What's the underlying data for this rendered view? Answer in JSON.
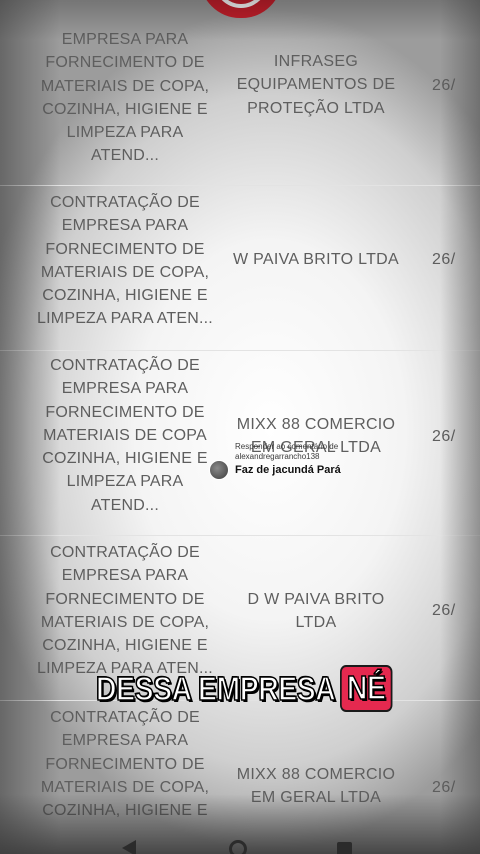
{
  "table": {
    "rows": [
      {
        "description": "EMPRESA PARA\nFORNECIMENTO DE\nMATERIAIS DE COPA,\nCOZINHA, HIGIENE E\nLIMPEZA PARA\nATEND...",
        "company": "INFRASEG\nEQUIPAMENTOS DE\nPROTEÇÃO LTDA",
        "date": "26/"
      },
      {
        "description": "CONTRATAÇÃO DE\nEMPRESA PARA\nFORNECIMENTO  DE\nMATERIAIS DE COPA,\nCOZINHA, HIGIENE E\nLIMPEZA PARA ATEN...",
        "company": "W PAIVA BRITO LTDA",
        "date": "26/"
      },
      {
        "description": "CONTRATAÇÃO DE\nEMPRESA PARA\nFORNECIMENTO DE\nMATERIAIS DE COPA\nCOZINHA, HIGIENE E\nLIMPEZA PARA\nATEND...",
        "company": "MIXX 88 COMERCIO\nEM GERAL LTDA",
        "date": "26/"
      },
      {
        "description": "CONTRATAÇÃO DE\nEMPRESA PARA\nFORNECIMENTO  DE\nMATERIAIS DE COPA,\nCOZINHA, HIGIENE E\nLIMPEZA PARA ATEN...",
        "company": "D W PAIVA  BRITO\nLTDA",
        "date": "26/"
      },
      {
        "description": "CONTRATAÇÃO DE\nEMPRESA PARA\nFORNECIMENTO DE\nMATERIAIS DE COPA,\nCOZINHA, HIGIENE E",
        "company": "MIXX 88 COMERCIO\nEM GERAL LTDA",
        "date": "26/"
      }
    ]
  },
  "comment": {
    "reply_label": "Responder ao comentário de",
    "handle": "alexandregarrancho138",
    "message": "Faz de jacundá Pará"
  },
  "caption": {
    "main": "DESSA EMPRESA",
    "highlight": "NÉ",
    "highlight_color": "#e5294f"
  },
  "icons": {
    "logo": "red-arch-logo",
    "nav_back": "back-triangle-icon",
    "nav_home": "home-circle-icon",
    "nav_recent": "recent-square-icon"
  }
}
